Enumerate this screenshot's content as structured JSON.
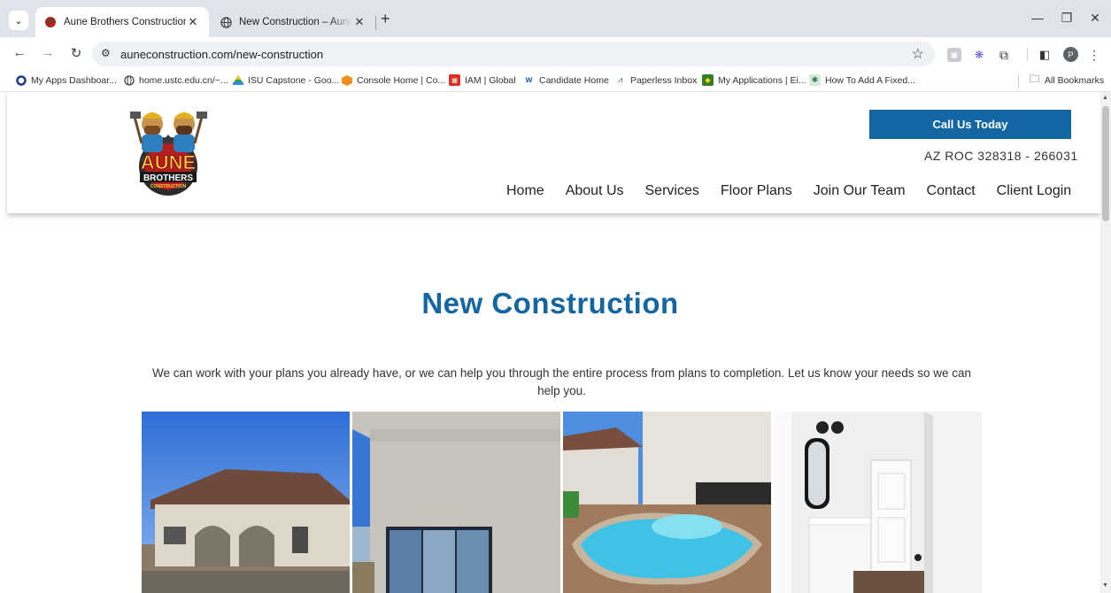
{
  "browser": {
    "tabs": [
      {
        "title": "Aune Brothers Construction",
        "active": true
      },
      {
        "title": "New Construction – Aune Cons",
        "active": false
      }
    ],
    "new_tab_symbol": "+",
    "address": "auneconstruction.com/new-construction",
    "bookmarks": [
      {
        "label": "My Apps Dashboar...",
        "icon": "circle-icon",
        "color": "#1a3d8f"
      },
      {
        "label": "home.ustc.edu.cn/~...",
        "icon": "globe-icon",
        "color": "#444"
      },
      {
        "label": "ISU Capstone - Goo...",
        "icon": "drive-icon",
        "color": "#1fa463"
      },
      {
        "label": "Console Home | Co...",
        "icon": "aws-icon",
        "color": "#f28b20"
      },
      {
        "label": "IAM | Global",
        "icon": "iam-icon",
        "color": "#d93025"
      },
      {
        "label": "Candidate Home",
        "icon": "workday-icon",
        "color": "#f5a623"
      },
      {
        "label": "Paperless Inbox",
        "icon": "paperless-icon",
        "color": "#3b7c5a"
      },
      {
        "label": "My Applications | Ei...",
        "icon": "deere-icon",
        "color": "#367c2b"
      },
      {
        "label": "How To Add A Fixed...",
        "icon": "bookmark-icon",
        "color": "#2c7a4b"
      }
    ],
    "all_bookmarks_label": "All Bookmarks",
    "profile_initial": "P"
  },
  "site": {
    "logo_text": [
      "AUNE",
      "BROTHERS",
      "CONSTRUCTION"
    ],
    "cta_label": "Call Us Today",
    "license": "AZ ROC 328318 - 266031",
    "nav": [
      "Home",
      "About Us",
      "Services",
      "Floor Plans",
      "Join Our Team",
      "Contact",
      "Client Login"
    ],
    "brand_color": "#1466a3"
  },
  "content": {
    "title": "New Construction",
    "intro": "We can work with your plans you already have, or we can help you through the entire process from plans to completion.  Let us know your needs so we can help you."
  }
}
